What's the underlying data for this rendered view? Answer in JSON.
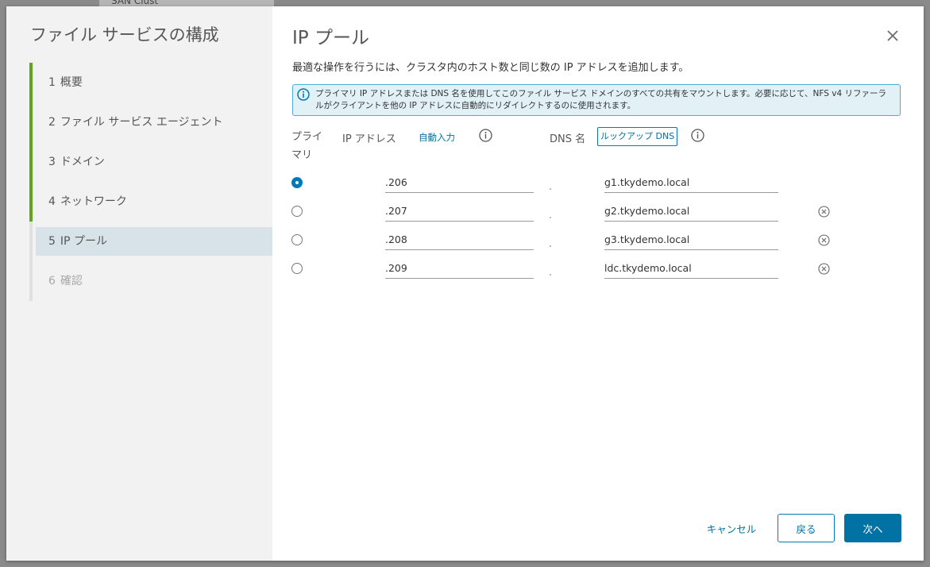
{
  "backdrop": {
    "title": "SAN Clust"
  },
  "wizard": {
    "title": "ファイル サービスの構成",
    "steps": [
      {
        "num": "1",
        "label": "概要",
        "state": "done"
      },
      {
        "num": "2",
        "label": "ファイル サービス エージェント",
        "state": "done"
      },
      {
        "num": "3",
        "label": "ドメイン",
        "state": "done"
      },
      {
        "num": "4",
        "label": "ネットワーク",
        "state": "done"
      },
      {
        "num": "5",
        "label": "IP プール",
        "state": "current"
      },
      {
        "num": "6",
        "label": "確認",
        "state": "disabled"
      }
    ]
  },
  "page": {
    "title": "IP プール",
    "subtitle": "最適な操作を行うには、クラスタ内のホスト数と同じ数の IP アドレスを追加します。",
    "alert": "プライマリ IP アドレスまたは DNS 名を使用してこのファイル サービス ドメインのすべての共有をマウントします。必要に応じて、NFS v4 リファーラルがクライアントを他の IP アドレスに自動的にリダイレクトするのに使用されます。"
  },
  "table": {
    "col_primary": "プライマリ",
    "col_ip": "IP アドレス",
    "auto_fill": "自動入力",
    "col_dns": "DNS 名",
    "lookup_dns": "ルックアップ DNS",
    "rows": [
      {
        "primary": true,
        "ip": ".206",
        "dns": "g1.tkydemo.local",
        "removable": false
      },
      {
        "primary": false,
        "ip": ".207",
        "dns": "g2.tkydemo.local",
        "removable": true
      },
      {
        "primary": false,
        "ip": ".208",
        "dns": "g3.tkydemo.local",
        "removable": true
      },
      {
        "primary": false,
        "ip": ".209",
        "dns": "ldc.tkydemo.local",
        "removable": true
      }
    ]
  },
  "footer": {
    "cancel": "キャンセル",
    "back": "戻る",
    "next": "次へ"
  },
  "colors": {
    "accent": "#0072a3",
    "step_done": "#62a420",
    "step_current_bg": "#d8e3e9",
    "alert_bg": "#e1f1f6",
    "alert_border": "#49afd9"
  }
}
